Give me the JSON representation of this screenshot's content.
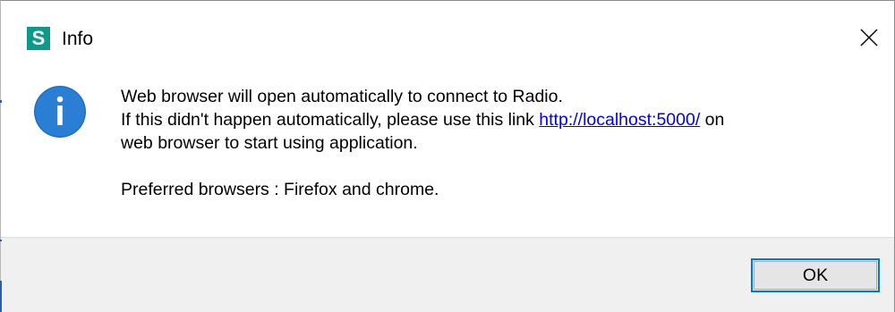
{
  "window": {
    "app_icon_letter": "S",
    "title": "Info",
    "close_glyph": "×",
    "close_icon": "close-icon",
    "accent_color": "#0078d7",
    "app_icon_color": "#0e9a8a"
  },
  "message": {
    "icon": "info-icon",
    "line1": "Web browser will open automatically to connect to Radio.",
    "line2_prefix": "If this didn't happen automatically, please use this link ",
    "link_text": "http://localhost:5000/",
    "line2_suffix": " on",
    "line3": "web browser to start using application.",
    "line4": "Preferred browsers : Firefox and chrome."
  },
  "footer": {
    "ok_label": "OK"
  }
}
